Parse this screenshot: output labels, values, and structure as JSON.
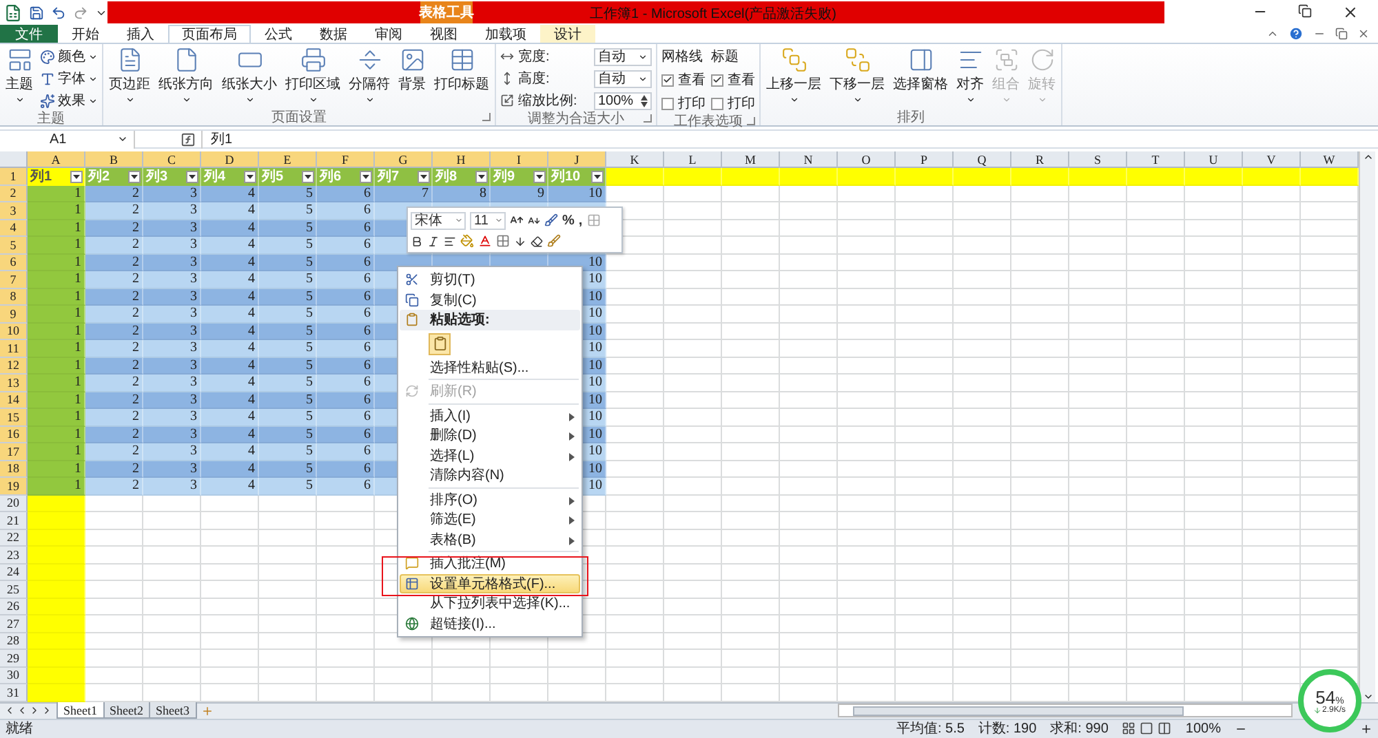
{
  "title_bar": {
    "title": "工作簿1 - Microsoft Excel(产品激活失败)",
    "context_label": "表格工具"
  },
  "tabs": [
    {
      "label": "文件",
      "kind": "file",
      "selected": false
    },
    {
      "label": "开始",
      "kind": "normal",
      "selected": false
    },
    {
      "label": "插入",
      "kind": "normal",
      "selected": false
    },
    {
      "label": "页面布局",
      "kind": "normal",
      "selected": true
    },
    {
      "label": "公式",
      "kind": "normal",
      "selected": false
    },
    {
      "label": "数据",
      "kind": "normal",
      "selected": false
    },
    {
      "label": "审阅",
      "kind": "normal",
      "selected": false
    },
    {
      "label": "视图",
      "kind": "normal",
      "selected": false
    },
    {
      "label": "加载项",
      "kind": "normal",
      "selected": false
    },
    {
      "label": "设计",
      "kind": "contextual",
      "selected": false
    }
  ],
  "ribbon": [
    {
      "label": "主题",
      "launcher": false,
      "items": [
        {
          "kind": "large",
          "label": "主题",
          "dropdown": true
        },
        {
          "kind": "small",
          "label": "颜色"
        },
        {
          "kind": "small",
          "label": "字体"
        },
        {
          "kind": "small",
          "label": "效果"
        }
      ]
    },
    {
      "label": "页面设置",
      "launcher": true,
      "items": [
        {
          "kind": "large",
          "label": "页边距",
          "dropdown": true
        },
        {
          "kind": "large",
          "label": "纸张方向",
          "dropdown": true
        },
        {
          "kind": "large",
          "label": "纸张大小",
          "dropdown": true
        },
        {
          "kind": "large",
          "label": "打印区域",
          "dropdown": true
        },
        {
          "kind": "large",
          "label": "分隔符",
          "dropdown": true
        },
        {
          "kind": "large",
          "label": "背景",
          "dropdown": false
        },
        {
          "kind": "large",
          "label": "打印标题",
          "dropdown": false
        }
      ]
    },
    {
      "label": "调整为合适大小",
      "launcher": true,
      "items": [
        {
          "kind": "field",
          "label": "宽度:",
          "value": "自动"
        },
        {
          "kind": "field",
          "label": "高度:",
          "value": "自动"
        },
        {
          "kind": "spin",
          "label": "缩放比例:",
          "value": "100%"
        }
      ]
    },
    {
      "label": "工作表选项",
      "launcher": true,
      "items": [
        {
          "kind": "checks",
          "label": "网格线",
          "options": [
            {
              "label": "查看",
              "checked": true
            },
            {
              "label": "打印",
              "checked": false
            }
          ]
        },
        {
          "kind": "checks",
          "label": "标题",
          "options": [
            {
              "label": "查看",
              "checked": true
            },
            {
              "label": "打印",
              "checked": false
            }
          ]
        }
      ]
    },
    {
      "label": "排列",
      "launcher": false,
      "items": [
        {
          "kind": "large",
          "label": "上移一层",
          "dropdown": true,
          "disabled": false
        },
        {
          "kind": "large",
          "label": "下移一层",
          "dropdown": true,
          "disabled": false
        },
        {
          "kind": "large",
          "label": "选择窗格",
          "dropdown": false,
          "disabled": false
        },
        {
          "kind": "large",
          "label": "对齐",
          "dropdown": true,
          "disabled": false
        },
        {
          "kind": "large",
          "label": "组合",
          "dropdown": true,
          "disabled": true
        },
        {
          "kind": "large",
          "label": "旋转",
          "dropdown": true,
          "disabled": true
        }
      ]
    }
  ],
  "formula_bar": {
    "name_box": "A1",
    "formula": "列1"
  },
  "columns": [
    {
      "label": "A",
      "selected": true
    },
    {
      "label": "B",
      "selected": true
    },
    {
      "label": "C",
      "selected": true
    },
    {
      "label": "D",
      "selected": true
    },
    {
      "label": "E",
      "selected": true
    },
    {
      "label": "F",
      "selected": true
    },
    {
      "label": "G",
      "selected": true
    },
    {
      "label": "H",
      "selected": true
    },
    {
      "label": "I",
      "selected": true
    },
    {
      "label": "J",
      "selected": true
    },
    {
      "label": "K",
      "selected": false
    },
    {
      "label": "L",
      "selected": false
    },
    {
      "label": "M",
      "selected": false
    },
    {
      "label": "N",
      "selected": false
    },
    {
      "label": "O",
      "selected": false
    },
    {
      "label": "P",
      "selected": false
    },
    {
      "label": "Q",
      "selected": false
    },
    {
      "label": "R",
      "selected": false
    },
    {
      "label": "S",
      "selected": false
    },
    {
      "label": "T",
      "selected": false
    },
    {
      "label": "U",
      "selected": false
    },
    {
      "label": "V",
      "selected": false
    },
    {
      "label": "W",
      "selected": false
    }
  ],
  "rows": [
    {
      "number": "1",
      "kind": "header",
      "selected": true,
      "cells": [
        {
          "text": "列1",
          "selected": true
        },
        {
          "text": "列2",
          "selected": false
        },
        {
          "text": "列3",
          "selected": false
        },
        {
          "text": "列4",
          "selected": false
        },
        {
          "text": "列5",
          "selected": false
        },
        {
          "text": "列6",
          "selected": false
        },
        {
          "text": "列7",
          "selected": false
        },
        {
          "text": "列8",
          "selected": false
        },
        {
          "text": "列9",
          "selected": false
        },
        {
          "text": "列10",
          "selected": false
        }
      ]
    },
    {
      "number": "2",
      "kind": "data",
      "selected": true,
      "cells": [
        "1",
        "2",
        "3",
        "4",
        "5",
        "6",
        "7",
        "8",
        "9",
        "10"
      ]
    },
    {
      "number": "3",
      "kind": "data",
      "selected": true,
      "cells": [
        "1",
        "2",
        "3",
        "4",
        "5",
        "6",
        null,
        null,
        null,
        null
      ]
    },
    {
      "number": "4",
      "kind": "data",
      "selected": true,
      "cells": [
        "1",
        "2",
        "3",
        "4",
        "5",
        "6",
        null,
        null,
        null,
        null
      ]
    },
    {
      "number": "5",
      "kind": "data",
      "selected": true,
      "cells": [
        "1",
        "2",
        "3",
        "4",
        "5",
        "6",
        null,
        null,
        null,
        null
      ]
    },
    {
      "number": "6",
      "kind": "data",
      "selected": true,
      "cells": [
        "1",
        "2",
        "3",
        "4",
        "5",
        "6",
        null,
        null,
        null,
        "10"
      ]
    },
    {
      "number": "7",
      "kind": "data",
      "selected": true,
      "cells": [
        "1",
        "2",
        "3",
        "4",
        "5",
        "6",
        null,
        null,
        null,
        "10"
      ]
    },
    {
      "number": "8",
      "kind": "data",
      "selected": true,
      "cells": [
        "1",
        "2",
        "3",
        "4",
        "5",
        "6",
        null,
        null,
        null,
        "10"
      ]
    },
    {
      "number": "9",
      "kind": "data",
      "selected": true,
      "cells": [
        "1",
        "2",
        "3",
        "4",
        "5",
        "6",
        null,
        null,
        null,
        "10"
      ]
    },
    {
      "number": "10",
      "kind": "data",
      "selected": true,
      "cells": [
        "1",
        "2",
        "3",
        "4",
        "5",
        "6",
        null,
        null,
        null,
        "10"
      ]
    },
    {
      "number": "11",
      "kind": "data",
      "selected": true,
      "cells": [
        "1",
        "2",
        "3",
        "4",
        "5",
        "6",
        null,
        null,
        null,
        "10"
      ]
    },
    {
      "number": "12",
      "kind": "data",
      "selected": true,
      "cells": [
        "1",
        "2",
        "3",
        "4",
        "5",
        "6",
        null,
        null,
        null,
        "10"
      ]
    },
    {
      "number": "13",
      "kind": "data",
      "selected": true,
      "cells": [
        "1",
        "2",
        "3",
        "4",
        "5",
        "6",
        null,
        null,
        null,
        "10"
      ]
    },
    {
      "number": "14",
      "kind": "data",
      "selected": true,
      "cells": [
        "1",
        "2",
        "3",
        "4",
        "5",
        "6",
        null,
        null,
        null,
        "10"
      ]
    },
    {
      "number": "15",
      "kind": "data",
      "selected": true,
      "cells": [
        "1",
        "2",
        "3",
        "4",
        "5",
        "6",
        null,
        null,
        null,
        "10"
      ]
    },
    {
      "number": "16",
      "kind": "data",
      "selected": true,
      "cells": [
        "1",
        "2",
        "3",
        "4",
        "5",
        "6",
        null,
        null,
        null,
        "10"
      ]
    },
    {
      "number": "17",
      "kind": "data",
      "selected": true,
      "cells": [
        "1",
        "2",
        "3",
        "4",
        "5",
        "6",
        null,
        null,
        null,
        "10"
      ]
    },
    {
      "number": "18",
      "kind": "data",
      "selected": true,
      "cells": [
        "1",
        "2",
        "3",
        "4",
        "5",
        "6",
        null,
        null,
        null,
        "10"
      ]
    },
    {
      "number": "19",
      "kind": "data",
      "selected": true,
      "cells": [
        "1",
        "2",
        "3",
        "4",
        "5",
        "6",
        null,
        null,
        null,
        "10"
      ]
    },
    {
      "number": "20",
      "kind": "empty",
      "selected": false
    },
    {
      "number": "21",
      "kind": "empty",
      "selected": false
    },
    {
      "number": "22",
      "kind": "empty",
      "selected": false
    },
    {
      "number": "23",
      "kind": "empty",
      "selected": false
    },
    {
      "number": "24",
      "kind": "empty",
      "selected": false
    },
    {
      "number": "25",
      "kind": "empty",
      "selected": false
    },
    {
      "number": "26",
      "kind": "empty",
      "selected": false
    },
    {
      "number": "27",
      "kind": "empty",
      "selected": false
    },
    {
      "number": "28",
      "kind": "empty",
      "selected": false
    },
    {
      "number": "29",
      "kind": "empty",
      "selected": false
    },
    {
      "number": "30",
      "kind": "empty",
      "selected": false
    },
    {
      "number": "31",
      "kind": "empty",
      "selected": false
    }
  ],
  "mini_toolbar": {
    "font": "宋体",
    "size": "11",
    "percent": "%",
    "comma": ","
  },
  "context_menu": [
    {
      "kind": "item",
      "label": "剪切(T)",
      "submenu": false,
      "disabled": false,
      "selected": false
    },
    {
      "kind": "item",
      "label": "复制(C)",
      "submenu": false,
      "disabled": false,
      "selected": false
    },
    {
      "kind": "heading",
      "label": "粘贴选项:",
      "submenu": false,
      "disabled": false,
      "selected": false
    },
    {
      "kind": "paste-option"
    },
    {
      "kind": "item",
      "label": "选择性粘贴(S)...",
      "submenu": false,
      "disabled": false,
      "selected": false
    },
    {
      "kind": "separator"
    },
    {
      "kind": "item",
      "label": "刷新(R)",
      "submenu": false,
      "disabled": true,
      "selected": false
    },
    {
      "kind": "separator"
    },
    {
      "kind": "item",
      "label": "插入(I)",
      "submenu": true,
      "disabled": false,
      "selected": false
    },
    {
      "kind": "item",
      "label": "删除(D)",
      "submenu": true,
      "disabled": false,
      "selected": false
    },
    {
      "kind": "item",
      "label": "选择(L)",
      "submenu": true,
      "disabled": false,
      "selected": false
    },
    {
      "kind": "item",
      "label": "清除内容(N)",
      "submenu": false,
      "disabled": false,
      "selected": false
    },
    {
      "kind": "separator"
    },
    {
      "kind": "item",
      "label": "排序(O)",
      "submenu": true,
      "disabled": false,
      "selected": false
    },
    {
      "kind": "item",
      "label": "筛选(E)",
      "submenu": true,
      "disabled": false,
      "selected": false
    },
    {
      "kind": "item",
      "label": "表格(B)",
      "submenu": true,
      "disabled": false,
      "selected": false
    },
    {
      "kind": "separator"
    },
    {
      "kind": "item",
      "label": "插入批注(M)",
      "submenu": false,
      "disabled": false,
      "selected": false
    },
    {
      "kind": "item",
      "label": "设置单元格格式(F)...",
      "submenu": false,
      "disabled": false,
      "selected": true
    },
    {
      "kind": "item",
      "label": "从下拉列表中选择(K)...",
      "submenu": false,
      "disabled": false,
      "selected": false
    },
    {
      "kind": "item",
      "label": "超链接(I)...",
      "submenu": false,
      "disabled": false,
      "selected": false
    }
  ],
  "sheet_tabs": [
    {
      "label": "Sheet1",
      "selected": true
    },
    {
      "label": "Sheet2",
      "selected": false
    },
    {
      "label": "Sheet3",
      "selected": false
    }
  ],
  "status_bar": {
    "ready": "就绪",
    "average": "平均值: 5.5",
    "count": "计数: 190",
    "sum": "求和: 990",
    "zoom": "100%"
  },
  "speed_widget": {
    "value": "54",
    "unit": "%",
    "speed": "2.9K/s"
  }
}
